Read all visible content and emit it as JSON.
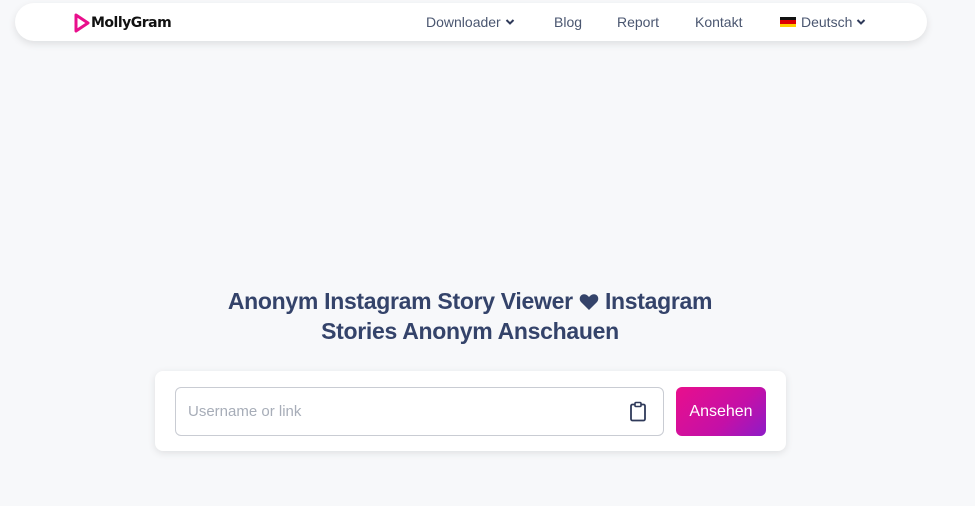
{
  "brand": {
    "name": "MollyGram",
    "accent": "#e90f8c"
  },
  "nav": {
    "items": [
      {
        "label": "Downloader",
        "has_dropdown": true
      },
      {
        "label": "Blog"
      },
      {
        "label": "Report"
      },
      {
        "label": "Kontakt"
      }
    ],
    "language": {
      "label": "Deutsch",
      "flag": "de-flag-icon"
    }
  },
  "hero": {
    "title_line1": "Anonym Instagram Story Viewer",
    "title_line1b": "Instagram",
    "title_line2": "Stories Anonym Anschauen",
    "heart_icon": "heart-icon"
  },
  "search": {
    "placeholder": "Username or link",
    "value": "",
    "paste_icon": "clipboard-icon",
    "submit_label": "Ansehen"
  },
  "colors": {
    "heading": "#34436a",
    "nav_text": "#4a5670",
    "button_gradient_start": "#e90f8c",
    "button_gradient_end": "#8d1cc7"
  }
}
